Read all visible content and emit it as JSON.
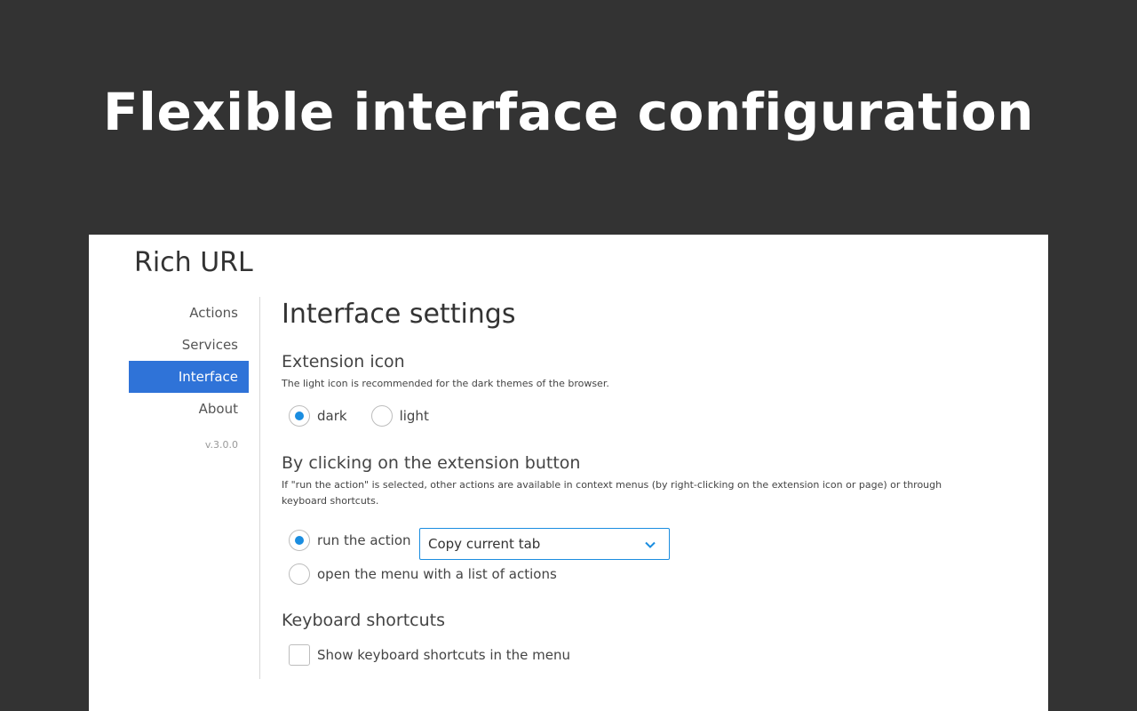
{
  "banner": {
    "title": "Flexible interface configuration"
  },
  "app": {
    "title": "Rich URL"
  },
  "sidebar": {
    "items": [
      {
        "label": "Actions"
      },
      {
        "label": "Services"
      },
      {
        "label": "Interface"
      },
      {
        "label": "About"
      }
    ],
    "active": "Interface",
    "version": "v.3.0.0"
  },
  "settings": {
    "page_title": "Interface settings",
    "extension_icon": {
      "title": "Extension icon",
      "hint": "The light icon is recommended for the dark themes of the browser.",
      "options": [
        {
          "label": "dark",
          "checked": true
        },
        {
          "label": "light",
          "checked": false
        }
      ]
    },
    "click_behavior": {
      "title": "By clicking on the extension button",
      "hint": "If \"run the action\" is selected, other actions are available in context menus (by right-clicking on the extension icon or page) or through keyboard shortcuts.",
      "options": [
        {
          "label": "run the action",
          "checked": true
        },
        {
          "label": "open the menu with a list of actions",
          "checked": false
        }
      ],
      "action_select": {
        "value": "Copy current tab"
      }
    },
    "keyboard": {
      "title": "Keyboard shortcuts",
      "show_shortcuts": {
        "label": "Show keyboard shortcuts in the menu",
        "checked": false
      }
    }
  },
  "colors": {
    "background": "#333333",
    "accent": "#2f73d8",
    "radio_dot": "#1a8de0"
  }
}
